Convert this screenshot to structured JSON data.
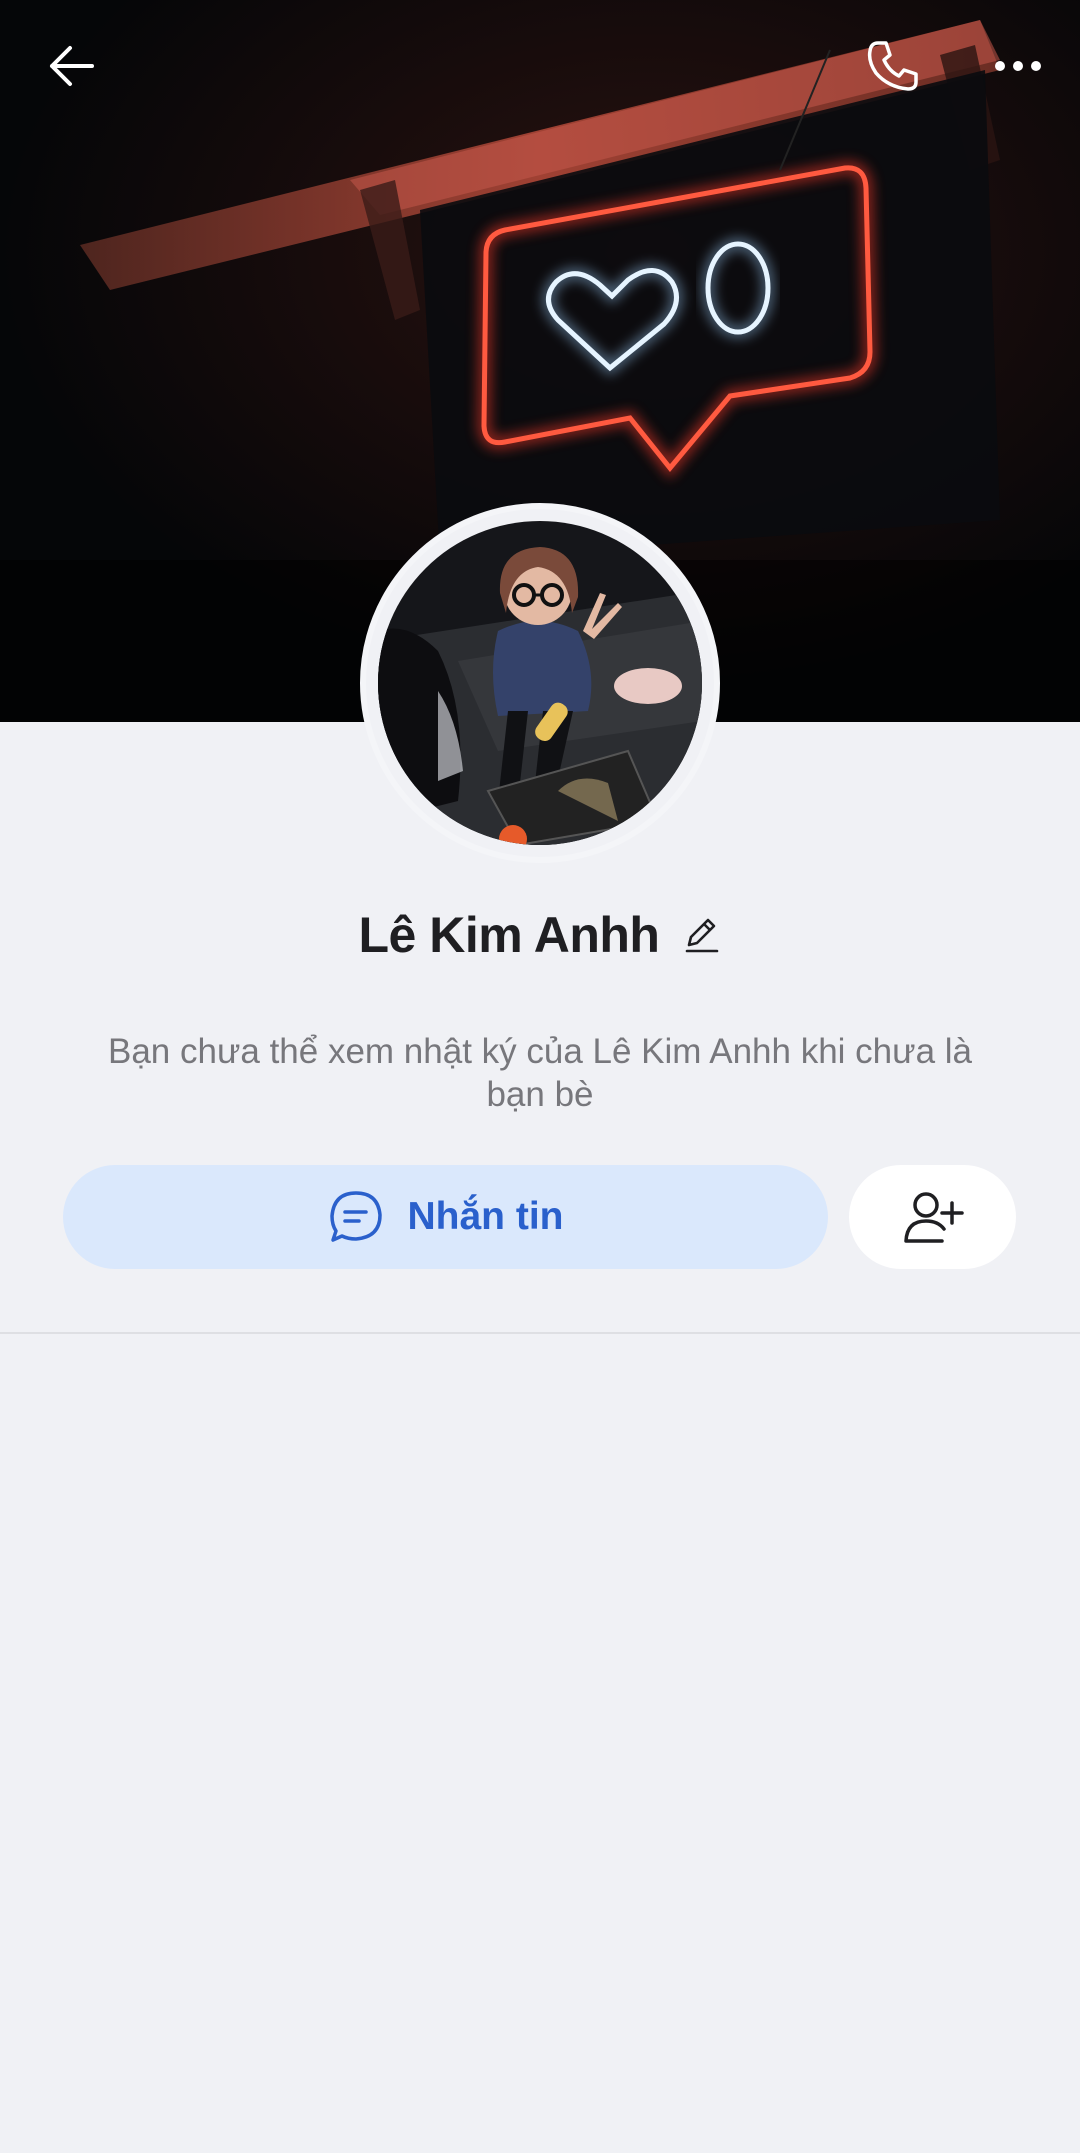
{
  "profile": {
    "name": "Lê Kim Anhh",
    "notice": "Bạn chưa thể xem nhật ký của Lê Kim Anhh khi chưa là bạn bè"
  },
  "actions": {
    "message_label": "Nhắn tin"
  },
  "icons": {
    "back": "arrow-left-icon",
    "call": "phone-icon",
    "more": "more-dots-icon",
    "edit": "pencil-icon",
    "message": "chat-bubble-icon",
    "add_friend": "add-user-icon"
  },
  "colors": {
    "background": "#f0f1f5",
    "accent": "#2a60cc",
    "message_button_bg": "#dae8fc",
    "neon_red": "#ff3b2a",
    "neon_blue": "#bfe3ff"
  }
}
